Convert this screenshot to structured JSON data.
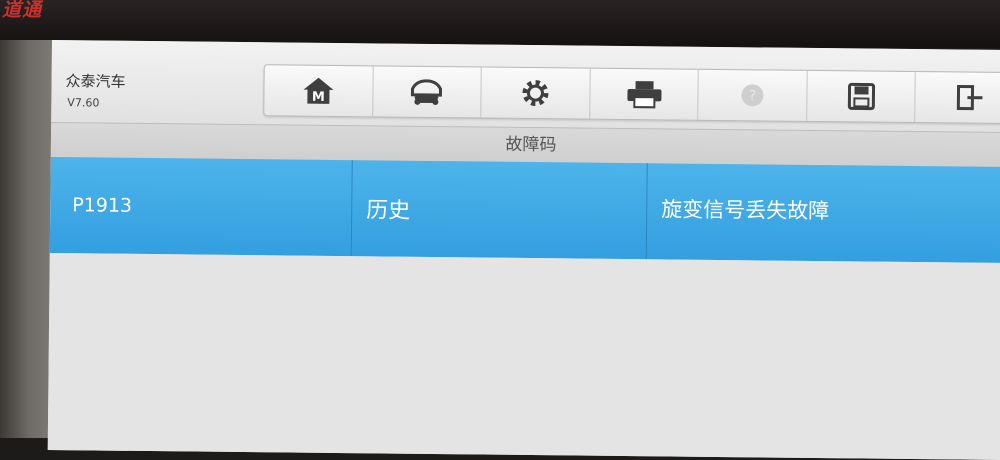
{
  "device": {
    "logo_text": "道通"
  },
  "app": {
    "title": "众泰汽车",
    "version": "V7.60"
  },
  "toolbar": {
    "buttons": [
      {
        "icon": "home-m-icon",
        "enabled": true
      },
      {
        "icon": "car-vehicle-icon",
        "enabled": true
      },
      {
        "icon": "gear-icon",
        "enabled": true
      },
      {
        "icon": "printer-icon",
        "enabled": true
      },
      {
        "icon": "help-icon",
        "enabled": false
      },
      {
        "icon": "save-icon",
        "enabled": true
      },
      {
        "icon": "exit-icon",
        "enabled": true
      }
    ]
  },
  "section": {
    "title": "故障码"
  },
  "dtc_list": [
    {
      "code": "P1913",
      "status": "历史",
      "description": "旋变信号丢失故障"
    }
  ],
  "colors": {
    "row_highlight": "#3aa6e6",
    "header_bg": "#efefef"
  }
}
